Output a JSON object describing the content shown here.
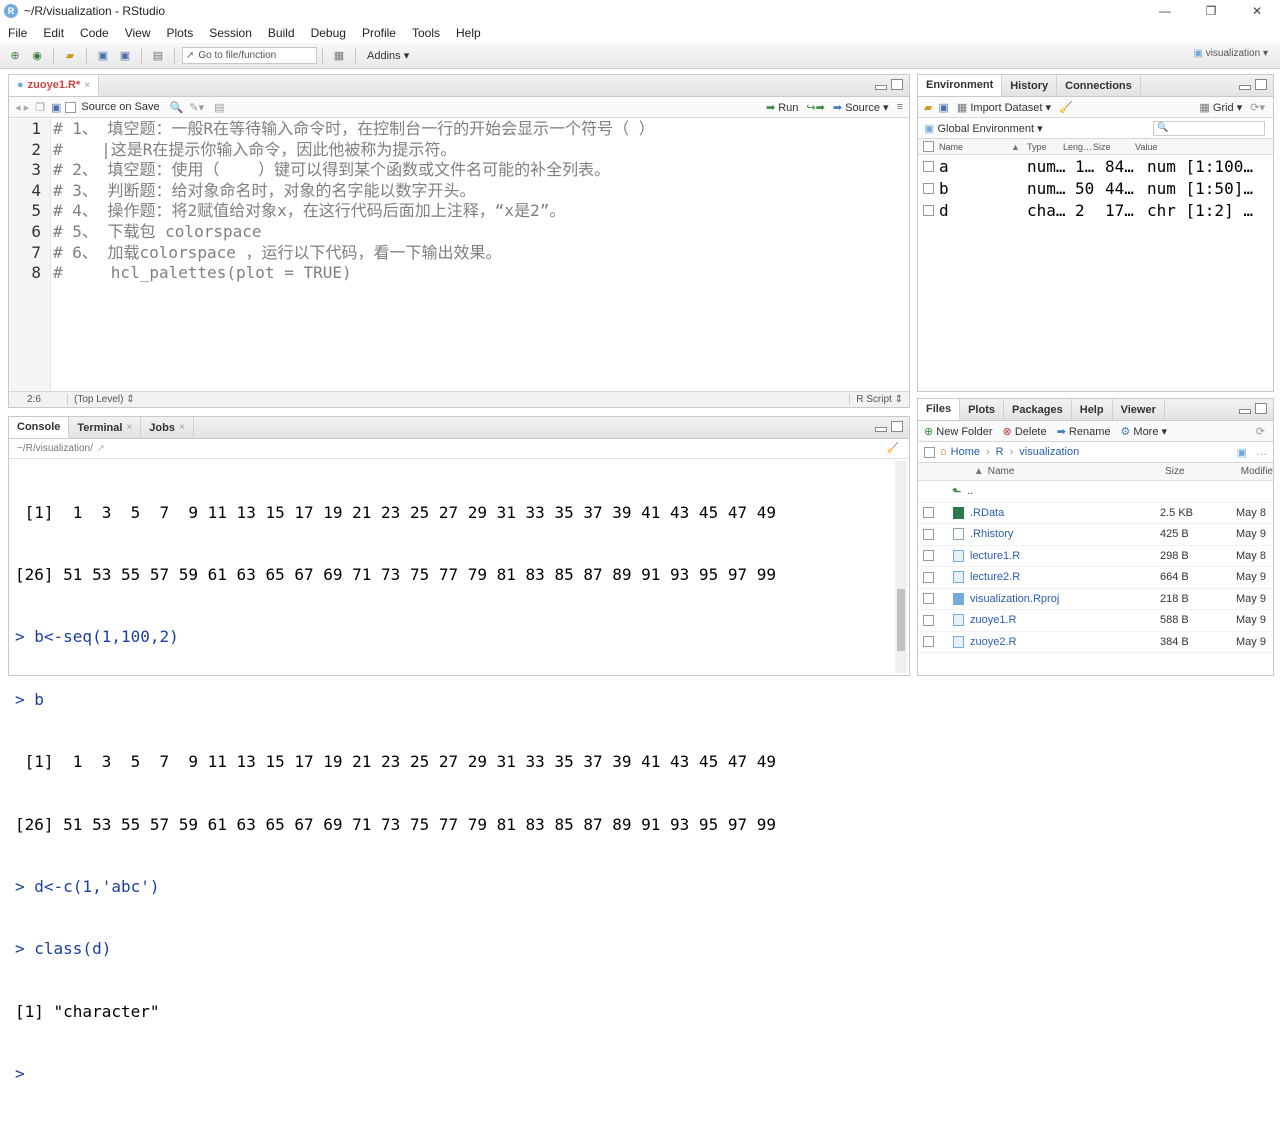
{
  "titlebar": {
    "app_icon": "R",
    "title": "~/R/visualization - RStudio"
  },
  "menu": [
    "File",
    "Edit",
    "Code",
    "View",
    "Plots",
    "Session",
    "Build",
    "Debug",
    "Profile",
    "Tools",
    "Help"
  ],
  "toolbar": {
    "goto_placeholder": "Go to file/function",
    "addins": "Addins",
    "project": "visualization"
  },
  "editor": {
    "tab_label": "zuoye1.R*",
    "source_on_save": "Source on Save",
    "run": "Run",
    "source": "Source",
    "lines": [
      "# 1、 填空题：一般R在等待输入命令时，在控制台一行的开始会显示一个符号（ ）",
      "#    |这是R在提示你输入命令，因此他被称为提示符。",
      "# 2、 填空题：使用（    ）键可以得到某个函数或文件名可能的补全列表。",
      "# 3、 判断题：给对象命名时，对象的名字能以数字开头。",
      "# 4、 操作题：将2赋值给对象x，在这行代码后面加上注释，“x是2”。",
      "# 5、 下载包 colorspace",
      "# 6、 加载colorspace ，运行以下代码，看一下输出效果。",
      "#     hcl_palettes(plot = TRUE)"
    ],
    "status": {
      "position": "2:6",
      "scope": "(Top Level)",
      "type": "R Script"
    }
  },
  "console": {
    "tabs": [
      "Console",
      "Terminal",
      "Jobs"
    ],
    "path": "~/R/visualization/",
    "lines": [
      {
        "kind": "out",
        "text": " [1]  1  3  5  7  9 11 13 15 17 19 21 23 25 27 29 31 33 35 37 39 41 43 45 47 49"
      },
      {
        "kind": "out",
        "text": "[26] 51 53 55 57 59 61 63 65 67 69 71 73 75 77 79 81 83 85 87 89 91 93 95 97 99"
      },
      {
        "kind": "cmd",
        "text": "> b<-seq(1,100,2)"
      },
      {
        "kind": "cmd",
        "text": "> b"
      },
      {
        "kind": "out",
        "text": " [1]  1  3  5  7  9 11 13 15 17 19 21 23 25 27 29 31 33 35 37 39 41 43 45 47 49"
      },
      {
        "kind": "out",
        "text": "[26] 51 53 55 57 59 61 63 65 67 69 71 73 75 77 79 81 83 85 87 89 91 93 95 97 99"
      },
      {
        "kind": "cmd",
        "text": "> d<-c(1,'abc')"
      },
      {
        "kind": "cmd",
        "text": "> class(d)"
      },
      {
        "kind": "out",
        "text": "[1] \"character\""
      },
      {
        "kind": "cmd",
        "text": "> "
      }
    ]
  },
  "env": {
    "tabs": [
      "Environment",
      "History",
      "Connections"
    ],
    "import_dataset": "Import Dataset",
    "grid": "Grid",
    "global_env": "Global Environment",
    "columns": [
      "Name",
      "Type",
      "Leng…",
      "Size",
      "Value"
    ],
    "rows": [
      {
        "name": "a",
        "type": "num…",
        "length": "1…",
        "size": "84…",
        "value": "num [1:100…"
      },
      {
        "name": "b",
        "type": "num…",
        "length": "50",
        "size": "44…",
        "value": "num [1:50]…"
      },
      {
        "name": "d",
        "type": "cha…",
        "length": "2",
        "size": "17…",
        "value": "chr [1:2] …"
      }
    ]
  },
  "files": {
    "tabs": [
      "Files",
      "Plots",
      "Packages",
      "Help",
      "Viewer"
    ],
    "new_folder": "New Folder",
    "delete": "Delete",
    "rename": "Rename",
    "more": "More",
    "breadcrumb": [
      "Home",
      "R",
      "visualization"
    ],
    "columns": [
      "Name",
      "Size",
      "Modifie"
    ],
    "up": "..",
    "rows": [
      {
        "name": ".RData",
        "size": "2.5 KB",
        "modified": "May 8"
      },
      {
        "name": ".Rhistory",
        "size": "425 B",
        "modified": "May 9"
      },
      {
        "name": "lecture1.R",
        "size": "298 B",
        "modified": "May 8"
      },
      {
        "name": "lecture2.R",
        "size": "664 B",
        "modified": "May 9"
      },
      {
        "name": "visualization.Rproj",
        "size": "218 B",
        "modified": "May 9"
      },
      {
        "name": "zuoye1.R",
        "size": "588 B",
        "modified": "May 9"
      },
      {
        "name": "zuoye2.R",
        "size": "384 B",
        "modified": "May 9"
      }
    ]
  }
}
